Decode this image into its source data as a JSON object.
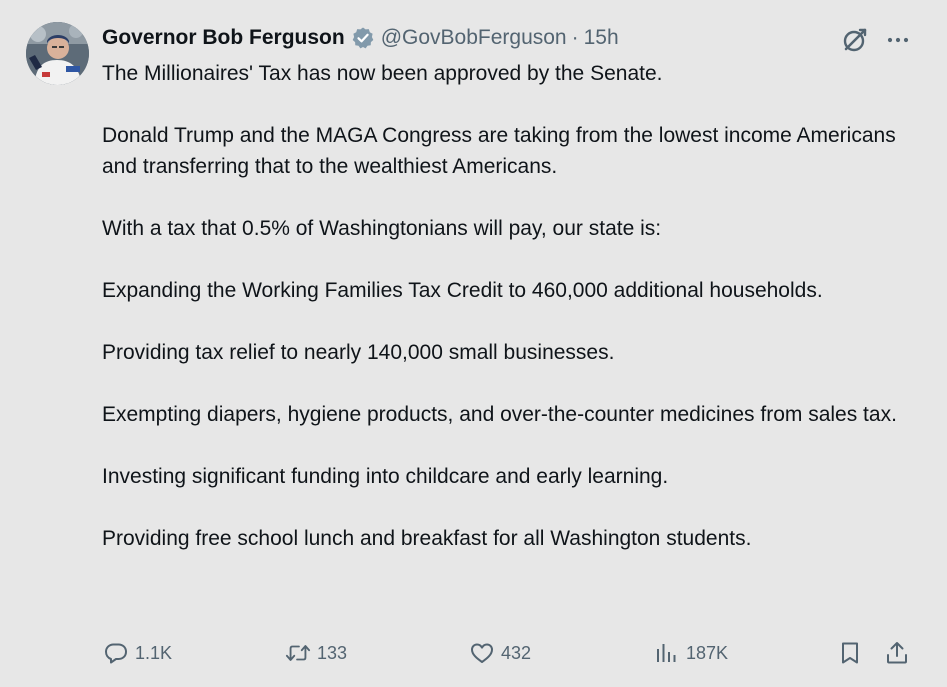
{
  "author": {
    "name": "Governor Bob Ferguson",
    "handle": "@GovBobFerguson",
    "separator": "·",
    "time": "15h",
    "verified_color": "#829aab"
  },
  "tweet": {
    "paragraphs": [
      "The Millionaires' Tax has now been approved by the Senate.",
      "Donald Trump and the MAGA Congress are taking from the lowest income Americans and transferring that to the wealthiest Americans.",
      "With a tax that 0.5% of Washingtonians will pay, our state is:",
      "Expanding the Working Families Tax Credit to 460,000 additional households.",
      "Providing tax relief to nearly 140,000 small businesses.",
      "Exempting diapers, hygiene products, and over-the-counter medicines from sales tax.",
      "Investing significant funding into childcare and early learning.",
      "Providing free school lunch and breakfast for all Washington students."
    ]
  },
  "actions": {
    "replies": "1.1K",
    "reposts": "133",
    "likes": "432",
    "views": "187K"
  },
  "icons": {
    "reply": "reply-icon",
    "repost": "repost-icon",
    "like": "heart-icon",
    "views": "analytics-icon",
    "bookmark": "bookmark-icon",
    "share": "share-icon",
    "grok": "grok-icon",
    "more": "more-icon"
  },
  "colors": {
    "background": "#e7e7e7",
    "text": "#0f1419",
    "muted": "#536471"
  }
}
